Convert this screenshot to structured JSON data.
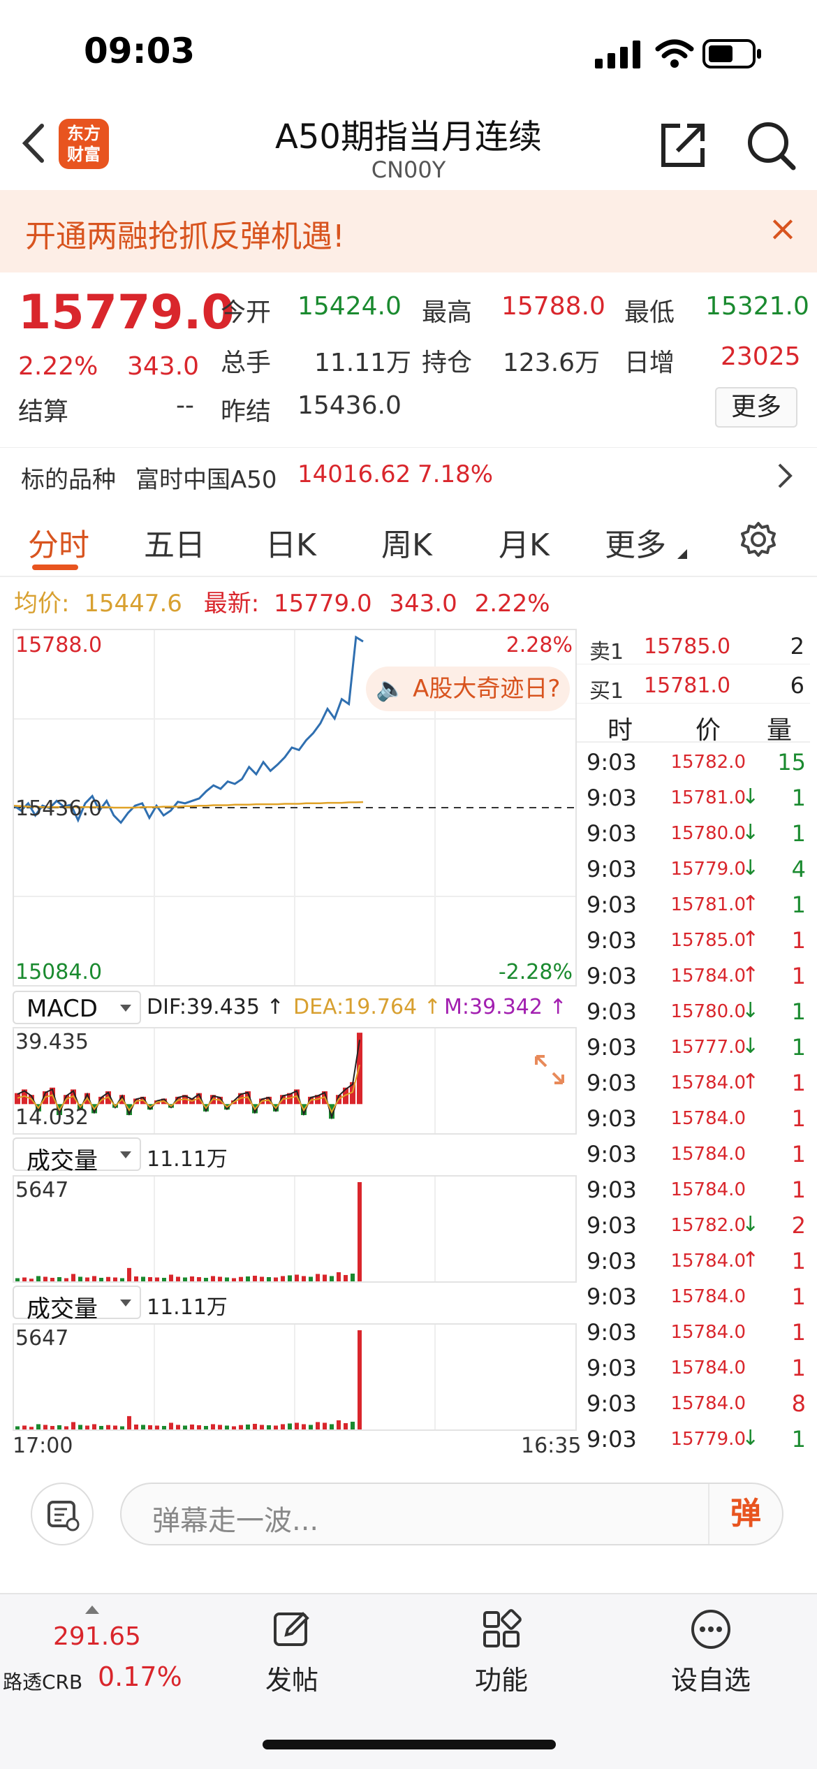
{
  "status_bar": {
    "time": "09:03"
  },
  "header": {
    "title": "A50期指当月连续",
    "code": "CN00Y",
    "logo_text": "东方财富"
  },
  "banner": {
    "text": "开通两融抢抓反弹机遇!",
    "close": "×"
  },
  "quote": {
    "price": "15779.0",
    "change_pct": "2.22%",
    "change": "343.0",
    "settle_label": "结算",
    "settle_value": "--",
    "fields": [
      {
        "label": "今开",
        "value": "15424.0",
        "color": "#1a8a2f"
      },
      {
        "label": "最高",
        "value": "15788.0",
        "color": "#d9262c"
      },
      {
        "label": "最低",
        "value": "15321.0",
        "color": "#1a8a2f"
      },
      {
        "label": "总手",
        "value": "11.11万",
        "color": "#222222"
      },
      {
        "label": "持仓",
        "value": "123.6万",
        "color": "#222222"
      },
      {
        "label": "日增",
        "value": "23025",
        "color": "#d9262c"
      },
      {
        "label": "昨结",
        "value": "15436.0",
        "color": "#222222"
      }
    ],
    "more_button": "更多"
  },
  "underlying": {
    "label": "标的品种",
    "name": "富时中国A50",
    "price": "14016.62",
    "pct": "7.18%"
  },
  "tabs": [
    "分时",
    "五日",
    "日K",
    "周K",
    "月K",
    "更多"
  ],
  "avg_line": {
    "avg_label": "均价:",
    "avg_value": "15447.6",
    "latest_label": "最新:",
    "latest_value": "15779.0",
    "change": "343.0",
    "pct": "2.22%"
  },
  "price_chart": {
    "high_label": "15788.0",
    "mid_label": "15436.0",
    "low_label": "15084.0",
    "up_pct": "2.28%",
    "down_pct": "-2.28%",
    "promo": "A股大奇迹日?"
  },
  "chart_data": [
    {
      "type": "line",
      "ylim": [
        15084.0,
        15788.0
      ],
      "reference": 15436.0,
      "series": [
        {
          "values": [
            15440,
            15430,
            15445,
            15420,
            15440,
            15435,
            15450,
            15438,
            15442,
            15410,
            15445,
            15460,
            15430,
            15450,
            15420,
            15405,
            15425,
            15440,
            15445,
            15415,
            15440,
            15420,
            15430,
            15448,
            15445,
            15450,
            15455,
            15470,
            15482,
            15475,
            15490,
            15485,
            15495,
            15520,
            15505,
            15530,
            15512,
            15525,
            15540,
            15560,
            15555,
            15575,
            15590,
            15610,
            15640,
            15620,
            15660,
            15650,
            15788,
            15779
          ]
        },
        {
          "values": [
            15440,
            15439,
            15438,
            15438,
            15437,
            15437,
            15437,
            15437,
            15437,
            15437,
            15437,
            15437,
            15437,
            15437,
            15436,
            15436,
            15436,
            15436,
            15437,
            15437,
            15437,
            15438,
            15438,
            15438,
            15439,
            15439,
            15440,
            15440,
            15441,
            15441,
            15441,
            15442,
            15442,
            15442,
            15443,
            15443,
            15443,
            15443,
            15444,
            15444,
            15444,
            15445,
            15445,
            15445,
            15446,
            15446,
            15446,
            15447,
            15447,
            15447.6
          ]
        }
      ]
    },
    {
      "type": "bar",
      "name": "MACD",
      "ylim": [
        -14.0,
        39.435
      ],
      "values": [
        6,
        8,
        5,
        -4,
        7,
        9,
        -6,
        5,
        8,
        -3,
        6,
        -5,
        4,
        7,
        -2,
        5,
        -6,
        3,
        4,
        -3,
        2,
        3,
        -2,
        4,
        5,
        3,
        6,
        -4,
        5,
        4,
        -3,
        2,
        6,
        7,
        -5,
        3,
        4,
        -4,
        5,
        6,
        8,
        -6,
        4,
        5,
        7,
        -8,
        5,
        9,
        12,
        39
      ]
    },
    {
      "type": "bar",
      "name": "成交量",
      "ylim": [
        0,
        5647
      ],
      "values": [
        180,
        220,
        150,
        300,
        260,
        200,
        240,
        180,
        420,
        260,
        220,
        300,
        200,
        250,
        220,
        180,
        760,
        280,
        260,
        240,
        220,
        200,
        380,
        260,
        220,
        280,
        240,
        200,
        300,
        260,
        220,
        180,
        250,
        280,
        320,
        260,
        240,
        220,
        300,
        340,
        380,
        300,
        260,
        420,
        380,
        300,
        520,
        360,
        440,
        5647
      ]
    }
  ],
  "macd": {
    "selector": "MACD",
    "dif": "DIF:39.435 ↑",
    "dea": "DEA:19.764 ↑",
    "m": "M:39.342 ↑",
    "top_label": "39.435",
    "bottom_label": "14.032"
  },
  "volume": {
    "selector": "成交量",
    "total": "11.11万",
    "max_label": "5647"
  },
  "time_axis": {
    "start": "17:00",
    "end": "16:35"
  },
  "order_book": {
    "asks": [
      {
        "label": "卖1",
        "price": "15785.0",
        "vol": "2"
      }
    ],
    "bids": [
      {
        "label": "买1",
        "price": "15781.0",
        "vol": "6"
      }
    ],
    "headers": [
      "时",
      "价",
      "量"
    ],
    "ticks": [
      {
        "t": "9:03",
        "p": "15782.0",
        "a": "",
        "v": "15",
        "c": "#1a8a2f"
      },
      {
        "t": "9:03",
        "p": "15781.0",
        "a": "↓",
        "v": "1",
        "c": "#1a8a2f"
      },
      {
        "t": "9:03",
        "p": "15780.0",
        "a": "↓",
        "v": "1",
        "c": "#1a8a2f"
      },
      {
        "t": "9:03",
        "p": "15779.0",
        "a": "↓",
        "v": "4",
        "c": "#1a8a2f"
      },
      {
        "t": "9:03",
        "p": "15781.0",
        "a": "↑",
        "v": "1",
        "c": "#1a8a2f"
      },
      {
        "t": "9:03",
        "p": "15785.0",
        "a": "↑",
        "v": "1",
        "c": "#d9262c"
      },
      {
        "t": "9:03",
        "p": "15784.0",
        "a": "↑",
        "v": "1",
        "c": "#d9262c"
      },
      {
        "t": "9:03",
        "p": "15780.0",
        "a": "↓",
        "v": "1",
        "c": "#1a8a2f"
      },
      {
        "t": "9:03",
        "p": "15777.0",
        "a": "↓",
        "v": "1",
        "c": "#1a8a2f"
      },
      {
        "t": "9:03",
        "p": "15784.0",
        "a": "↑",
        "v": "1",
        "c": "#d9262c"
      },
      {
        "t": "9:03",
        "p": "15784.0",
        "a": "",
        "v": "1",
        "c": "#d9262c"
      },
      {
        "t": "9:03",
        "p": "15784.0",
        "a": "",
        "v": "1",
        "c": "#d9262c"
      },
      {
        "t": "9:03",
        "p": "15784.0",
        "a": "",
        "v": "1",
        "c": "#d9262c"
      },
      {
        "t": "9:03",
        "p": "15782.0",
        "a": "↓",
        "v": "2",
        "c": "#d9262c"
      },
      {
        "t": "9:03",
        "p": "15784.0",
        "a": "↑",
        "v": "1",
        "c": "#d9262c"
      },
      {
        "t": "9:03",
        "p": "15784.0",
        "a": "",
        "v": "1",
        "c": "#d9262c"
      },
      {
        "t": "9:03",
        "p": "15784.0",
        "a": "",
        "v": "1",
        "c": "#d9262c"
      },
      {
        "t": "9:03",
        "p": "15784.0",
        "a": "",
        "v": "1",
        "c": "#d9262c"
      },
      {
        "t": "9:03",
        "p": "15784.0",
        "a": "",
        "v": "8",
        "c": "#d9262c"
      },
      {
        "t": "9:03",
        "p": "15779.0",
        "a": "↓",
        "v": "1",
        "c": "#1a8a2f"
      }
    ]
  },
  "danmu": {
    "placeholder": "弹幕走一波...",
    "button": "弹"
  },
  "bottom_bar": {
    "index_value": "291.65",
    "index_name": "路透CRB",
    "index_pct": "0.17%",
    "items": [
      {
        "label": "发帖",
        "icon": "edit-icon"
      },
      {
        "label": "功能",
        "icon": "grid-icon"
      },
      {
        "label": "设自选",
        "icon": "more-dots-icon"
      }
    ]
  }
}
